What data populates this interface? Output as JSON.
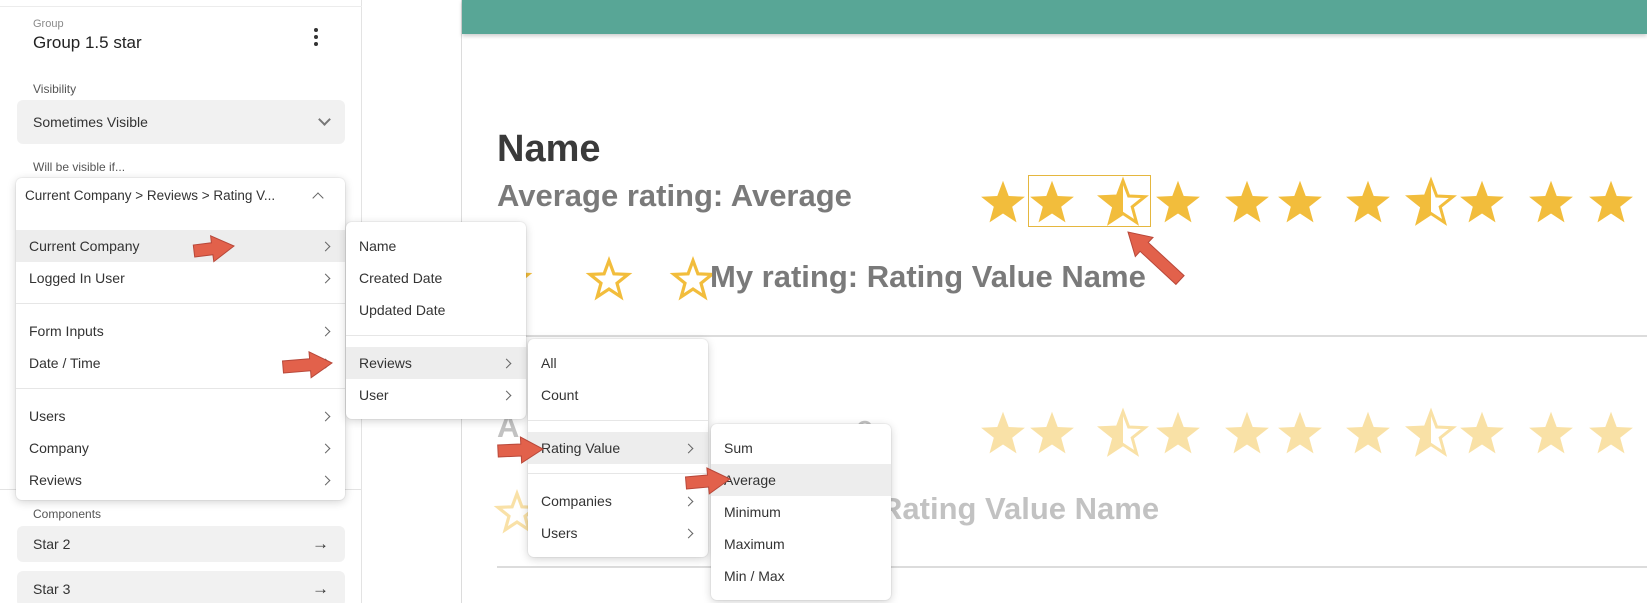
{
  "panel": {
    "group_caption": "Group",
    "group_title": "Group 1.5 star",
    "visibility_label": "Visibility",
    "visibility_value": "Sometimes Visible",
    "condition_label": "Will be visible if...",
    "components_label": "Components",
    "components": [
      {
        "label": "Star 2"
      },
      {
        "label": "Star 3"
      }
    ]
  },
  "menus": {
    "root": {
      "header": "Current Company > Reviews > Rating V...",
      "items": [
        {
          "label": "Current Company",
          "has_submenu": true,
          "active": true
        },
        {
          "label": "Logged In User",
          "has_submenu": true
        },
        {
          "label": "Form Inputs",
          "has_submenu": true
        },
        {
          "label": "Date / Time",
          "has_submenu": true
        },
        {
          "label": "Users",
          "has_submenu": true
        },
        {
          "label": "Company",
          "has_submenu": true
        },
        {
          "label": "Reviews",
          "has_submenu": true
        }
      ]
    },
    "company": {
      "items": [
        {
          "label": "Name"
        },
        {
          "label": "Created Date"
        },
        {
          "label": "Updated Date"
        },
        {
          "label": "Reviews",
          "has_submenu": true,
          "active": true
        },
        {
          "label": "User",
          "has_submenu": true
        }
      ]
    },
    "reviews": {
      "items": [
        {
          "label": "All"
        },
        {
          "label": "Count"
        },
        {
          "label": "Rating Value",
          "has_submenu": true,
          "active": true
        },
        {
          "label": "Companies",
          "has_submenu": true
        },
        {
          "label": "Users",
          "has_submenu": true
        }
      ]
    },
    "rating": {
      "items": [
        {
          "label": "Sum"
        },
        {
          "label": "Average",
          "active": true
        },
        {
          "label": "Minimum"
        },
        {
          "label": "Maximum"
        },
        {
          "label": "Min / Max"
        }
      ]
    }
  },
  "canvas": {
    "banner_color": "#58a696",
    "star_color": "#f2bd3c",
    "callout_color": "#e2614b",
    "name_heading": "Name",
    "avg_rating_text": "Average rating: Average",
    "my_rating_text": "My rating: Rating Value Name",
    "ghost_avg_text_partial": "A",
    "ghost_avg_text_tail": "e",
    "ghost_my_rating_text_partial": "Rating Value Name"
  },
  "icons": {
    "more": "more-vert-icon",
    "dropdown": "chevron-down-icon",
    "collapse": "chevron-up-icon",
    "submenu": "chevron-right-icon",
    "navigate": "arrow-right-icon",
    "star": "star-icon",
    "half_star": "star-half-icon",
    "empty_star": "star-outline-icon"
  }
}
